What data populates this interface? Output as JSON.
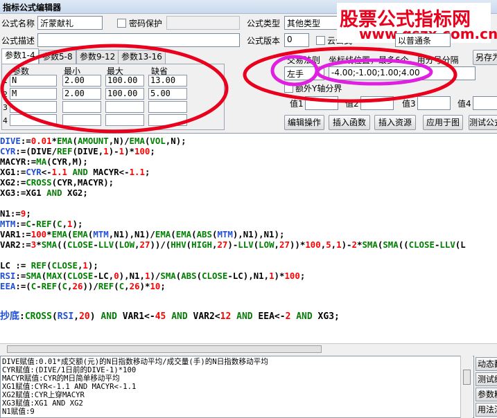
{
  "window": {
    "title": "指标公式编辑器"
  },
  "watermark": {
    "title": "股票公式指标网",
    "url": "www.gszx.com.cn"
  },
  "form": {
    "name_label": "公式名称",
    "name_value": "沂蒙献礼",
    "password_label": "密码保护",
    "type_label": "公式类型",
    "type_value": "其他类型",
    "desc_label": "公式描述",
    "version_label": "公式版本",
    "version_value": "0",
    "cloud_label": "云公式",
    "axis_label": "坐标线位置，最多6个，用分号分隔",
    "axis_value": "-4.00;-1.00;1.00;4.00",
    "trade_label": "交易法则",
    "trade_value": "左手",
    "extra_axis_label": "额外Y轴分界",
    "val1_label": "值1",
    "val2_label": "值2",
    "val3_label": "值3",
    "val4_label": "值4",
    "extra_value": "以普通条"
  },
  "tabs": [
    {
      "label": "参数1-4"
    },
    {
      "label": "参数5-8"
    },
    {
      "label": "参数9-12"
    },
    {
      "label": "参数13-16"
    }
  ],
  "params": {
    "headers": {
      "name": "参数",
      "min": "最小",
      "max": "最大",
      "default": "缺省"
    },
    "rows": [
      {
        "num": "1",
        "name": "N",
        "min": "2.00",
        "max": "100.00",
        "default": "13.00"
      },
      {
        "num": "2",
        "name": "M",
        "min": "2.00",
        "max": "100.00",
        "default": "5.00"
      },
      {
        "num": "3",
        "name": "",
        "min": "",
        "max": "",
        "default": ""
      },
      {
        "num": "4",
        "name": "",
        "min": "",
        "max": "",
        "default": ""
      }
    ]
  },
  "buttons": {
    "save_as": "另存为",
    "edit_ops": "编辑操作",
    "insert_func": "插入函数",
    "insert_res": "插入资源",
    "apply_chart": "应用于图",
    "test": "测试公式"
  },
  "side_buttons": [
    "动态翻译",
    "测试结果",
    "参数精灵",
    "用法注释"
  ],
  "code": {
    "l1": [
      "DIVE",
      ":=",
      "0.01",
      "*",
      "EMA",
      "(",
      "AMOUNT",
      ",N)/",
      "EMA",
      "(",
      "VOL",
      ",N);"
    ],
    "l2": [
      "CYR",
      ":=(DIVE/",
      "REF",
      "(DIVE,",
      "1",
      ")-",
      "1",
      ")*",
      "100",
      ";"
    ],
    "l3": [
      "MACYR",
      ":=",
      "MA",
      "(CYR,M);"
    ],
    "l4": [
      "XG1",
      ":=",
      "CYR",
      "<-",
      "1.1",
      " AND ",
      "MACYR",
      "<-",
      "1.1",
      ";"
    ],
    "l5": [
      "XG2",
      ":=",
      "CROSS",
      "(CYR,MACYR);"
    ],
    "l6": [
      "XG3",
      ":=XG1 ",
      "AND",
      " XG2;"
    ],
    "l7": [
      "N1",
      ":=",
      "9",
      ";"
    ],
    "l8": [
      "MTM",
      ":=",
      "C",
      "-",
      "REF",
      "(",
      "C",
      ",",
      "1",
      ");"
    ],
    "l9": [
      "VAR1",
      ":=",
      "100",
      "*",
      "EMA",
      "(",
      "EMA",
      "(",
      "MTM",
      ",N1),N1)/",
      "EMA",
      "(",
      "EMA",
      "(",
      "ABS",
      "(",
      "MTM",
      "),N1),N1);"
    ],
    "l10": [
      "VAR2",
      ":=",
      "3",
      "*",
      "SMA",
      "((",
      "CLOSE",
      "-",
      "LLV",
      "(",
      "LOW",
      ",",
      "27",
      "))/(",
      "HHV",
      "(",
      "HIGH",
      ",",
      "27",
      ")-",
      "LLV",
      "(",
      "LOW",
      ",",
      "27",
      "))*",
      "100",
      ",",
      "5",
      ",",
      "1",
      ")-",
      "2",
      "*",
      "SMA",
      "(",
      "SMA",
      "((",
      "CLOSE",
      "-",
      "LLV",
      "(L"
    ],
    "l11": [
      "LC",
      " := ",
      "REF",
      "(",
      "CLOSE",
      ",",
      "1",
      ");"
    ],
    "l12": [
      "RSI",
      ":=",
      "SMA",
      "(",
      "MAX",
      "(",
      "CLOSE",
      "-LC,",
      "0",
      "),N1,",
      "1",
      ")/",
      "SMA",
      "(",
      "ABS",
      "(",
      "CLOSE",
      "-LC),N1,",
      "1",
      ")*",
      "100",
      ";"
    ],
    "l13": [
      "EEA",
      ":=(",
      "C",
      "-",
      "REF",
      "(",
      "C",
      ",",
      "26",
      "))/",
      "REF",
      "(",
      "C",
      ",",
      "26",
      ")*",
      "10",
      ";"
    ],
    "l14": [
      "抄底",
      ":",
      "CROSS",
      "(",
      "RSI",
      ",",
      "20",
      ") ",
      "AND",
      " VAR1<-",
      "45",
      " ",
      "AND",
      " VAR2<",
      "12",
      " ",
      "AND",
      " EEA<-",
      "2",
      " ",
      "AND",
      " XG3;"
    ]
  },
  "description_lines": [
    "DIVE赋值:0.01*成交额(元)的N日指数移动平均/成交量(手)的N日指数移动平均",
    "CYR赋值:(DIVE/1日前的DIVE-1)*100",
    "MACYR赋值:CYR的M日简单移动平均",
    "XG1赋值:CYR<-1.1 AND MACYR<-1.1",
    "XG2赋值:CYR上穿MACYR",
    "XG3赋值:XG1 AND XG2",
    "N1赋值:9"
  ],
  "colors": {
    "annotation_red": "#e8001c",
    "annotation_magenta": "#e020e0",
    "var_blue": "#1f4fd6",
    "func_green": "#008000"
  }
}
